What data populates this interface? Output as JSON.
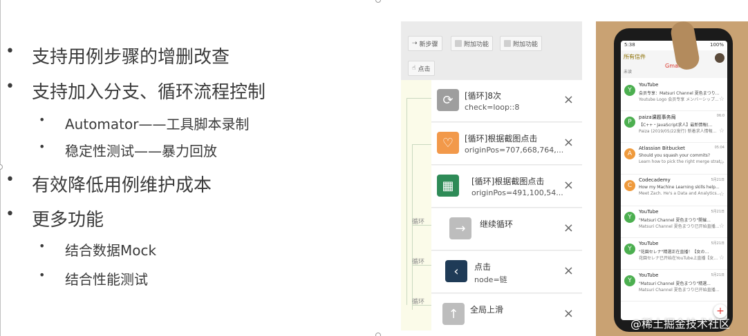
{
  "slide": {
    "bullets": [
      {
        "text": "支持用例步骤的增删改查",
        "sub": []
      },
      {
        "text": "支持加入分支、循环流程控制",
        "sub": [
          "Automator——工具脚本录制",
          "稳定性测试——暴力回放"
        ]
      },
      {
        "text": "有效降低用例维护成本",
        "sub": []
      },
      {
        "text": "更多功能",
        "sub": [
          "结合数据Mock",
          "结合性能测试"
        ]
      }
    ],
    "bullet_glyph": "•"
  },
  "toolbar": {
    "new_step": "新步骤",
    "addon_1": "附加功能",
    "addon_2": "附加功能",
    "tap": "点击"
  },
  "flow": {
    "loop_labels": [
      "循环",
      "循环",
      "循环"
    ]
  },
  "steps": [
    {
      "title": "[循环]8次",
      "detail": "check=loop::8",
      "icon": "loop-icon",
      "icon_color": "#9e9e9e"
    },
    {
      "title": "[循环]根据截图点击",
      "detail": "originPos=707,668,764,...",
      "icon": "heart-app-icon",
      "icon_color": "#f2994a"
    },
    {
      "title": "[循环]根据截图点击",
      "detail": "originPos=491,100,54...",
      "icon": "app-thumbnail-icon",
      "icon_color": "#2e8b57"
    },
    {
      "title": "继续循环",
      "detail": "",
      "icon": "arrow-right-icon",
      "icon_color": "#bdbdbd"
    },
    {
      "title": "点击",
      "detail": "node=链",
      "icon": "back-chevron-icon",
      "icon_color": "#1f3b57"
    },
    {
      "title": "全局上滑",
      "detail": "",
      "icon": "arrow-up-icon",
      "icon_color": "#bdbdbd"
    }
  ],
  "close_glyph": "×",
  "phone": {
    "status_time": "5:38",
    "status_battery": "100%",
    "app_title": "Gmail",
    "folder": "所有信件",
    "section": "未读",
    "mails": [
      {
        "initial": "Y",
        "color": "#4caf50",
        "from": "YouTube",
        "subject": "会员专享：Matsuri Channel 夏色まつり...",
        "preview": "Youtube Logo 会员专享 メンバーシップ...",
        "date": ""
      },
      {
        "initial": "P",
        "color": "#4caf50",
        "from": "paiza课题事务局",
        "subject": "【C++・JavaScript求人】最新情報(...",
        "preview": "Paiza (2019/05/22发行) 新着求人情報...",
        "date": "06:0"
      },
      {
        "initial": "A",
        "color": "#ef9a3c",
        "from": "Atlassian Bitbucket",
        "subject": "Should you squash your commits?",
        "preview": "Learn how to pick the right merge strat...",
        "date": "05:04"
      },
      {
        "initial": "C",
        "color": "#ef9a3c",
        "from": "Codecademy",
        "subject": "How my Machine Learning skills help...",
        "preview": "Meet Zach. He's a Data and Analytics...",
        "date": "5月21日"
      },
      {
        "initial": "Y",
        "color": "#4caf50",
        "from": "YouTube",
        "subject": "\"Matsuri Channel 夏色まつり\"開催...",
        "preview": "Matsuri Channel 夏色まつり已开始直播...",
        "date": "5月21日"
      },
      {
        "initial": "Y",
        "color": "#4caf50",
        "from": "YouTube",
        "subject": "\"花園セレナ\"精選正在直播！【女の...",
        "preview": "花園セレナ已开始在YouTube上直播【女...",
        "date": "5月21日"
      },
      {
        "initial": "Y",
        "color": "#4caf50",
        "from": "YouTube",
        "subject": "\"Matsuri Channel 夏色まつり\"精選...",
        "preview": "Matsuri Channel 夏色まつり已开始直播...",
        "date": "5月21日"
      }
    ],
    "fab_glyph": "+"
  },
  "watermark": "@稀土掘金技术社区"
}
